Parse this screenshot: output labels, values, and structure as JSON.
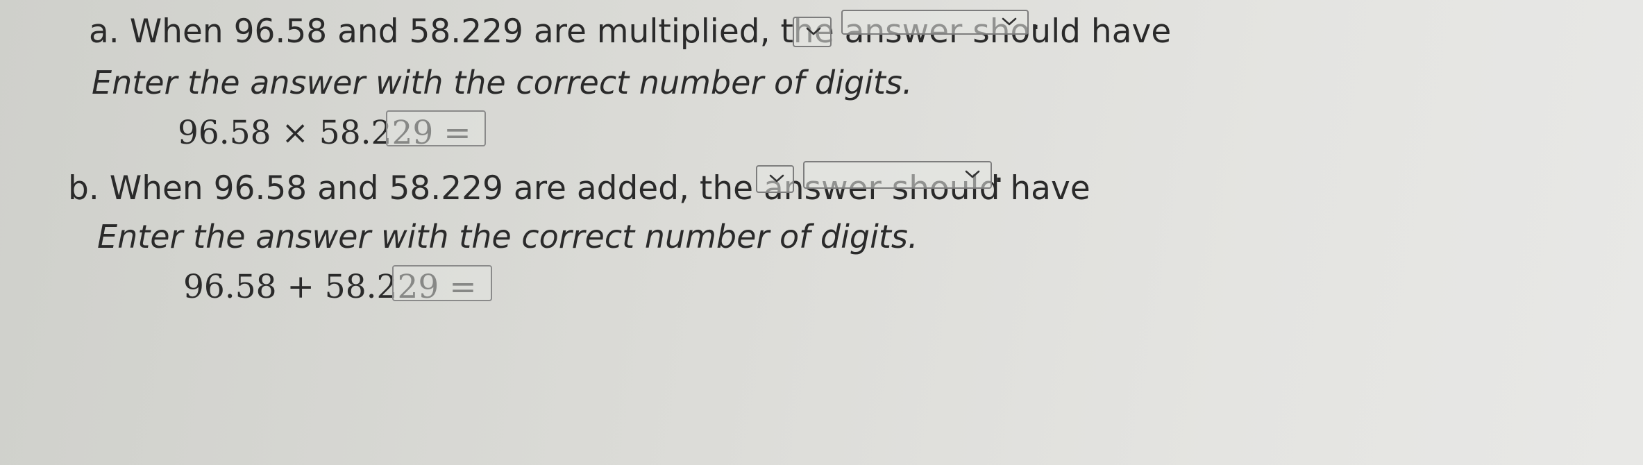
{
  "part_a": {
    "marker": "a.",
    "question": "When 96.58 and 58.229 are multiplied, the answer should have",
    "select_1_value": "",
    "select_2_value": "",
    "end_punct": ".",
    "instruction": "Enter the answer with the correct number of digits.",
    "equation": "96.58 × 58.229 =",
    "answer_value": ""
  },
  "part_b": {
    "marker": "b.",
    "question": "When 96.58 and 58.229 are added, the answer should have",
    "select_1_value": "",
    "select_2_value": "",
    "end_punct": ".",
    "instruction": "Enter the answer with the correct number of digits.",
    "equation": "96.58 + 58.229 =",
    "answer_value": ""
  },
  "icons": {
    "dropdown": "chevron-down-icon"
  }
}
